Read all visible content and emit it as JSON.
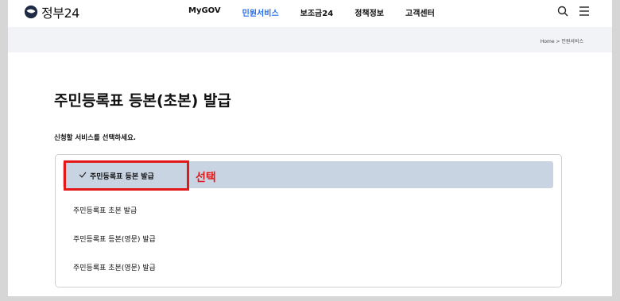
{
  "header": {
    "logo_text": "정부24",
    "nav": [
      "MyGOV",
      "민원서비스",
      "보조금24",
      "정책정보",
      "고객센터"
    ],
    "active_nav": "민원서비스",
    "icons": [
      "search-icon",
      "menu-icon"
    ]
  },
  "breadcrumb": "Home > 민원서비스",
  "page": {
    "title": "주민등록표 등본(초본) 발급",
    "subtitle": "신청할 서비스를 선택하세요."
  },
  "options": [
    {
      "label": "주민등록표 등본 발급",
      "selected": true
    },
    {
      "label": "주민등록표 초본 발급",
      "selected": false
    },
    {
      "label": "주민등록표 등본(영문) 발급",
      "selected": false
    },
    {
      "label": "주민등록표 초본(영문) 발급",
      "selected": false
    }
  ],
  "annotation": {
    "text": "선택",
    "color": "#e31919"
  },
  "colors": {
    "accent": "#256ef4",
    "selected_bg": "#c9d4e2"
  }
}
